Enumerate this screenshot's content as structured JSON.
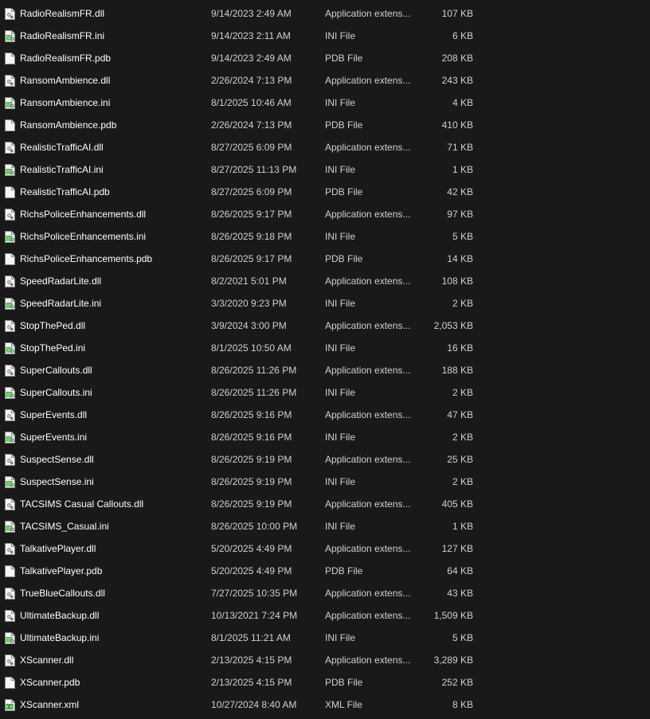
{
  "files": [
    {
      "name": "RadioRealismFR.dll",
      "date": "9/14/2023 2:49 AM",
      "type": "Application extens...",
      "size": "107 KB",
      "icon": "dll-file-icon"
    },
    {
      "name": "RadioRealismFR.ini",
      "date": "9/14/2023 2:11 AM",
      "type": "INI File",
      "size": "6 KB",
      "icon": "ini-file-icon"
    },
    {
      "name": "RadioRealismFR.pdb",
      "date": "9/14/2023 2:49 AM",
      "type": "PDB File",
      "size": "208 KB",
      "icon": "blank-file-icon"
    },
    {
      "name": "RansomAmbience.dll",
      "date": "2/26/2024 7:13 PM",
      "type": "Application extens...",
      "size": "243 KB",
      "icon": "dll-file-icon"
    },
    {
      "name": "RansomAmbience.ini",
      "date": "8/1/2025 10:46 AM",
      "type": "INI File",
      "size": "4 KB",
      "icon": "ini-file-icon"
    },
    {
      "name": "RansomAmbience.pdb",
      "date": "2/26/2024 7:13 PM",
      "type": "PDB File",
      "size": "410 KB",
      "icon": "blank-file-icon"
    },
    {
      "name": "RealisticTrafficAI.dll",
      "date": "8/27/2025 6:09 PM",
      "type": "Application extens...",
      "size": "71 KB",
      "icon": "dll-file-icon"
    },
    {
      "name": "RealisticTrafficAI.ini",
      "date": "8/27/2025 11:13 PM",
      "type": "INI File",
      "size": "1 KB",
      "icon": "ini-file-icon"
    },
    {
      "name": "RealisticTrafficAI.pdb",
      "date": "8/27/2025 6:09 PM",
      "type": "PDB File",
      "size": "42 KB",
      "icon": "blank-file-icon"
    },
    {
      "name": "RichsPoliceEnhancements.dll",
      "date": "8/26/2025 9:17 PM",
      "type": "Application extens...",
      "size": "97 KB",
      "icon": "dll-file-icon"
    },
    {
      "name": "RichsPoliceEnhancements.ini",
      "date": "8/26/2025 9:18 PM",
      "type": "INI File",
      "size": "5 KB",
      "icon": "ini-file-icon"
    },
    {
      "name": "RichsPoliceEnhancements.pdb",
      "date": "8/26/2025 9:17 PM",
      "type": "PDB File",
      "size": "14 KB",
      "icon": "blank-file-icon"
    },
    {
      "name": "SpeedRadarLite.dll",
      "date": "8/2/2021 5:01 PM",
      "type": "Application extens...",
      "size": "108 KB",
      "icon": "dll-file-icon"
    },
    {
      "name": "SpeedRadarLite.ini",
      "date": "3/3/2020 9:23 PM",
      "type": "INI File",
      "size": "2 KB",
      "icon": "ini-file-icon"
    },
    {
      "name": "StopThePed.dll",
      "date": "3/9/2024 3:00 PM",
      "type": "Application extens...",
      "size": "2,053 KB",
      "icon": "dll-file-icon"
    },
    {
      "name": "StopThePed.ini",
      "date": "8/1/2025 10:50 AM",
      "type": "INI File",
      "size": "16 KB",
      "icon": "ini-file-icon"
    },
    {
      "name": "SuperCallouts.dll",
      "date": "8/26/2025 11:26 PM",
      "type": "Application extens...",
      "size": "188 KB",
      "icon": "dll-file-icon"
    },
    {
      "name": "SuperCallouts.ini",
      "date": "8/26/2025 11:26 PM",
      "type": "INI File",
      "size": "2 KB",
      "icon": "ini-file-icon"
    },
    {
      "name": "SuperEvents.dll",
      "date": "8/26/2025 9:16 PM",
      "type": "Application extens...",
      "size": "47 KB",
      "icon": "dll-file-icon"
    },
    {
      "name": "SuperEvents.ini",
      "date": "8/26/2025 9:16 PM",
      "type": "INI File",
      "size": "2 KB",
      "icon": "ini-file-icon"
    },
    {
      "name": "SuspectSense.dll",
      "date": "8/26/2025 9:19 PM",
      "type": "Application extens...",
      "size": "25 KB",
      "icon": "dll-file-icon"
    },
    {
      "name": "SuspectSense.ini",
      "date": "8/26/2025 9:19 PM",
      "type": "INI File",
      "size": "2 KB",
      "icon": "ini-file-icon"
    },
    {
      "name": "TACSIMS Casual Callouts.dll",
      "date": "8/26/2025 9:19 PM",
      "type": "Application extens...",
      "size": "405 KB",
      "icon": "dll-file-icon"
    },
    {
      "name": "TACSIMS_Casual.ini",
      "date": "8/26/2025 10:00 PM",
      "type": "INI File",
      "size": "1 KB",
      "icon": "ini-file-icon"
    },
    {
      "name": "TalkativePlayer.dll",
      "date": "5/20/2025 4:49 PM",
      "type": "Application extens...",
      "size": "127 KB",
      "icon": "dll-file-icon"
    },
    {
      "name": "TalkativePlayer.pdb",
      "date": "5/20/2025 4:49 PM",
      "type": "PDB File",
      "size": "64 KB",
      "icon": "blank-file-icon"
    },
    {
      "name": "TrueBlueCallouts.dll",
      "date": "7/27/2025 10:35 PM",
      "type": "Application extens...",
      "size": "43 KB",
      "icon": "dll-file-icon"
    },
    {
      "name": "UltimateBackup.dll",
      "date": "10/13/2021 7:24 PM",
      "type": "Application extens...",
      "size": "1,509 KB",
      "icon": "dll-file-icon"
    },
    {
      "name": "UltimateBackup.ini",
      "date": "8/1/2025 11:21 AM",
      "type": "INI File",
      "size": "5 KB",
      "icon": "ini-file-icon"
    },
    {
      "name": "XScanner.dll",
      "date": "2/13/2025 4:15 PM",
      "type": "Application extens...",
      "size": "3,289 KB",
      "icon": "dll-file-icon"
    },
    {
      "name": "XScanner.pdb",
      "date": "2/13/2025 4:15 PM",
      "type": "PDB File",
      "size": "252 KB",
      "icon": "blank-file-icon"
    },
    {
      "name": "XScanner.xml",
      "date": "10/27/2024 8:40 AM",
      "type": "XML File",
      "size": "8 KB",
      "icon": "xml-file-icon"
    }
  ],
  "colors": {
    "background": "#191919",
    "text_primary": "#ffffff",
    "text_secondary": "#d0d0d0",
    "ini_icon_accent": "#3fb33f"
  }
}
